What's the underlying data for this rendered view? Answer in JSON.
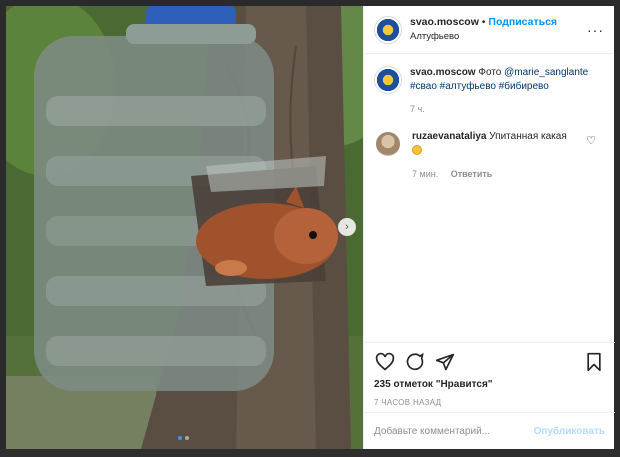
{
  "post": {
    "username": "svao.moscow",
    "separator": "•",
    "follow_label": "Подписаться",
    "location": "Алтуфьево",
    "more_icon": "more-horizontal-icon"
  },
  "caption": {
    "username": "svao.moscow",
    "text_prefix": "Фото",
    "mention": "@marie_sanglante",
    "hashtags": "#свао #алтуфьево #бибирево",
    "age": "7 ч."
  },
  "comments": [
    {
      "username": "ruzaevanataliya",
      "text": "Упитанная какая",
      "emoji": "smiling-face-with-heart-eyes",
      "age": "7 мин.",
      "reply_label": "Ответить"
    }
  ],
  "actions": {
    "like_icon": "heart-icon",
    "comment_icon": "comment-icon",
    "share_icon": "share-icon",
    "save_icon": "bookmark-icon"
  },
  "likes_text": "235 отметок \"Нравится\"",
  "post_time": "7 ЧАСОВ НАЗАД",
  "comment_box": {
    "placeholder": "Добавьте комментарий...",
    "publish_label": "Опубликовать"
  },
  "carousel": {
    "current": 1,
    "total": 2
  },
  "colors": {
    "link": "#00376b",
    "follow": "#0095f6",
    "publish_disabled": "#b3dbff",
    "active_dot": "#3897f0"
  }
}
